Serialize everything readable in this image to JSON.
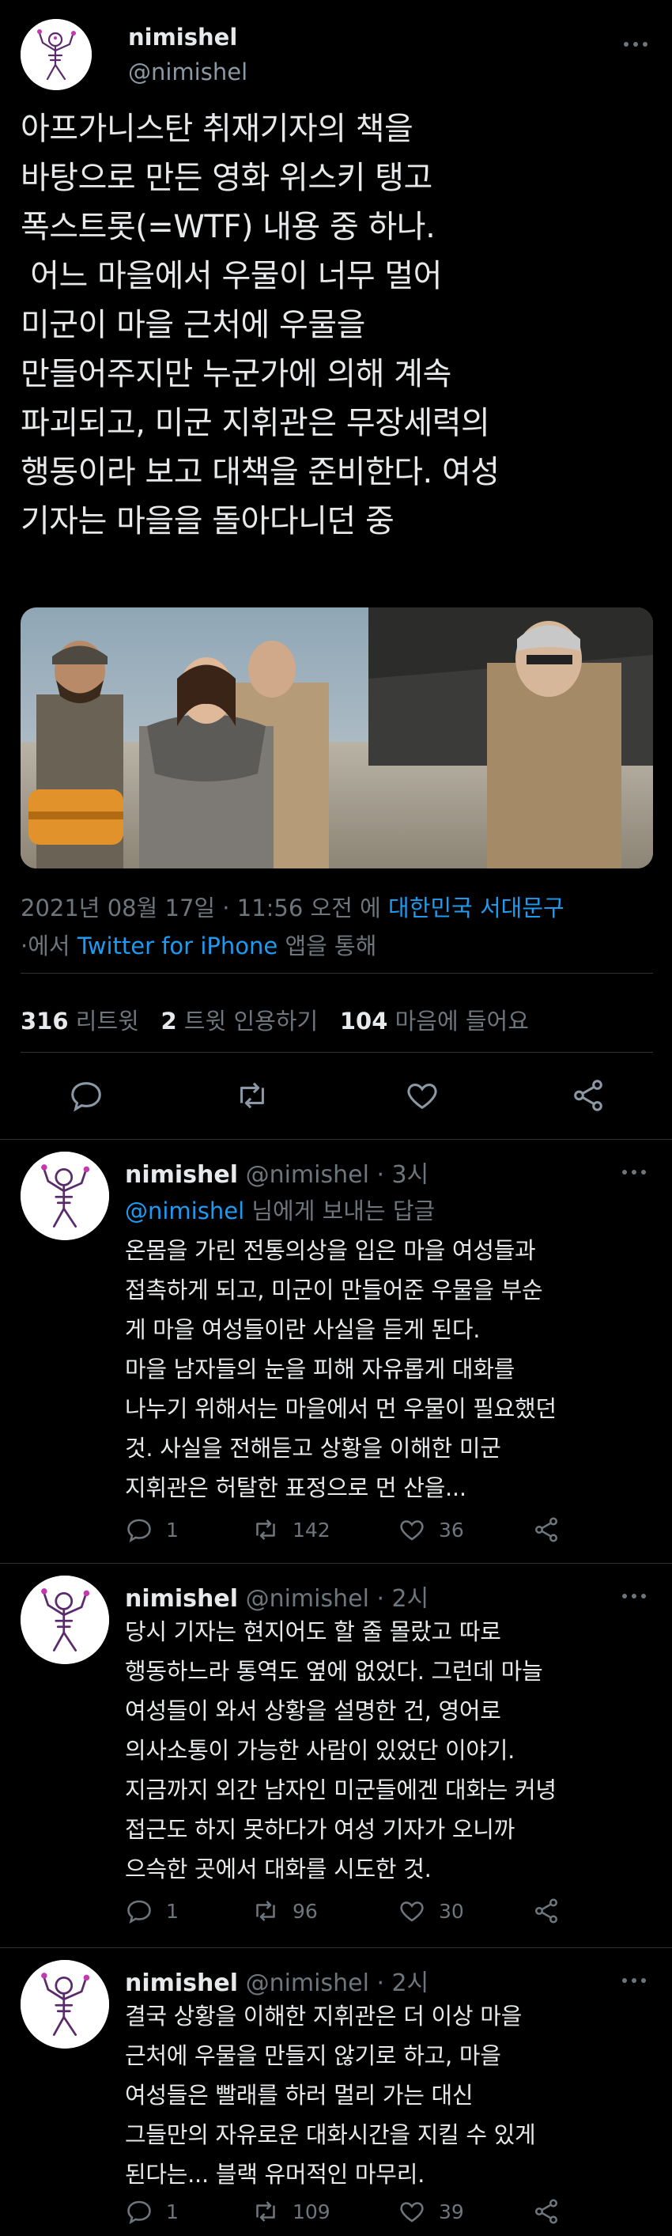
{
  "author": {
    "name": "nimishel",
    "handle": "@nimishel"
  },
  "main_tweet": {
    "text": "아프가니스탄 취재기자의 책을\n바탕으로 만든 영화 위스키 탱고\n폭스트롯(=WTF) 내용 중 하나.\n 어느 마을에서 우물이 너무 멀어\n미군이 마을 근처에 우물을\n만들어주지만 누군가에 의해 계속\n파괴되고, 미군 지휘관은 무장세력의\n행동이라 보고 대책을 준비한다. 여성\n기자는 마을을 돌아다니던 중",
    "meta_date": "2021년 08월 17일 · 11:56 오전 에",
    "meta_location": "대한민국 서대문구",
    "meta_via_prefix": "·에서",
    "meta_client": "Twitter for iPhone",
    "meta_via_suffix": "앱을 통해",
    "retweets_count": "316",
    "retweets_label": "리트윗",
    "quotes_count": "2",
    "quotes_label": "트윗 인용하기",
    "likes_count": "104",
    "likes_label": "마음에 들어요"
  },
  "replies": [
    {
      "name": "nimishel",
      "handle": "@nimishel · 3시",
      "reply_to_handle": "@nimishel",
      "reply_to_suffix": "님에게 보내는 답글",
      "text": "온몸을 가린 전통의상을 입은 마을 여성들과\n접촉하게 되고, 미군이 만들어준 우물을 부순\n게 마을 여성들이란 사실을 듣게 된다.\n마을 남자들의 눈을 피해 자유롭게 대화를\n나누기 위해서는 마을에서 먼 우물이 필요했던\n것. 사실을 전해듣고 상황을 이해한 미군\n지휘관은 허탈한 표정으로 먼 산을...",
      "reply_count": "1",
      "retweet_count": "142",
      "like_count": "36"
    },
    {
      "name": "nimishel",
      "handle": "@nimishel · 2시",
      "text": "당시 기자는 현지어도 할 줄 몰랐고 따로\n행동하느라 통역도 옆에 없었다. 그런데 마늘\n여성들이 와서 상황을 설명한 건, 영어로\n의사소통이 가능한 사람이 있었단 이야기.\n지금까지 외간 남자인 미군들에겐 대화는 커녕\n접근도 하지 못하다가 여성 기자가 오니까\n으슥한 곳에서 대화를 시도한 것.",
      "reply_count": "1",
      "retweet_count": "96",
      "like_count": "30"
    },
    {
      "name": "nimishel",
      "handle": "@nimishel · 2시",
      "text": "결국 상황을 이해한 지휘관은 더 이상 마을\n근처에 우물을 만들지 않기로 하고, 마을\n여성들은 빨래를 하러 멀리 가는 대신\n그들만의 자유로운 대화시간을 지킬 수 있게\n된다는... 블랙 유머적인 마무리.",
      "reply_count": "1",
      "retweet_count": "109",
      "like_count": "39"
    }
  ],
  "icons": {
    "avatar": "cartoon-figure-avatar",
    "more": "more-dots-icon",
    "reply": "reply-bubble-icon",
    "retweet": "retweet-icon",
    "like": "heart-icon",
    "share": "share-icon"
  },
  "colors": {
    "background": "#000000",
    "text": "#e7e9ea",
    "secondary": "#6e767d",
    "link": "#1d9bf0",
    "divider": "#2f3336"
  }
}
